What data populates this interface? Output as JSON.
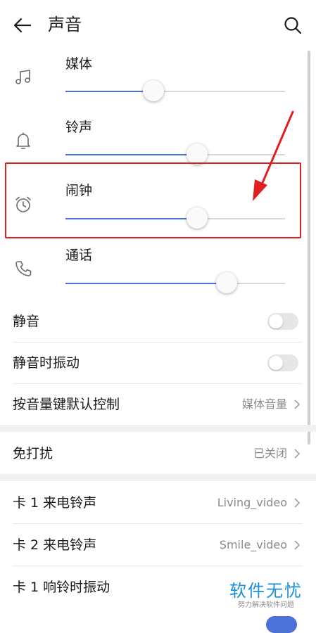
{
  "header": {
    "title": "声音",
    "back_icon": "arrow-left-icon",
    "search_icon": "search-icon"
  },
  "volume": [
    {
      "label": "媒体",
      "icon": "music-note-icon",
      "level_percent": 40
    },
    {
      "label": "铃声",
      "icon": "bell-icon",
      "level_percent": 60
    },
    {
      "label": "闹钟",
      "icon": "alarm-clock-icon",
      "level_percent": 60
    },
    {
      "label": "通话",
      "icon": "phone-icon",
      "level_percent": 73.5
    }
  ],
  "settings": [
    {
      "label": "静音",
      "toggle": false
    },
    {
      "label": "静音时振动",
      "toggle": false
    },
    {
      "label": "按音量键默认控制",
      "value": "媒体音量"
    },
    {
      "label": "免打扰",
      "value": "已关闭"
    },
    {
      "label": "卡 1 来电铃声",
      "value": "Living_video"
    },
    {
      "label": "卡 2 来电铃声",
      "value": "Smile_video"
    },
    {
      "label": "卡 1 响铃时振动",
      "value": ""
    }
  ],
  "watermark": {
    "title": "软件无忧",
    "subtitle": "努力解决软件问题"
  },
  "colors": {
    "accent": "#4a72d9",
    "highlight": "#e02020",
    "watermark": "#1d8fd8"
  }
}
